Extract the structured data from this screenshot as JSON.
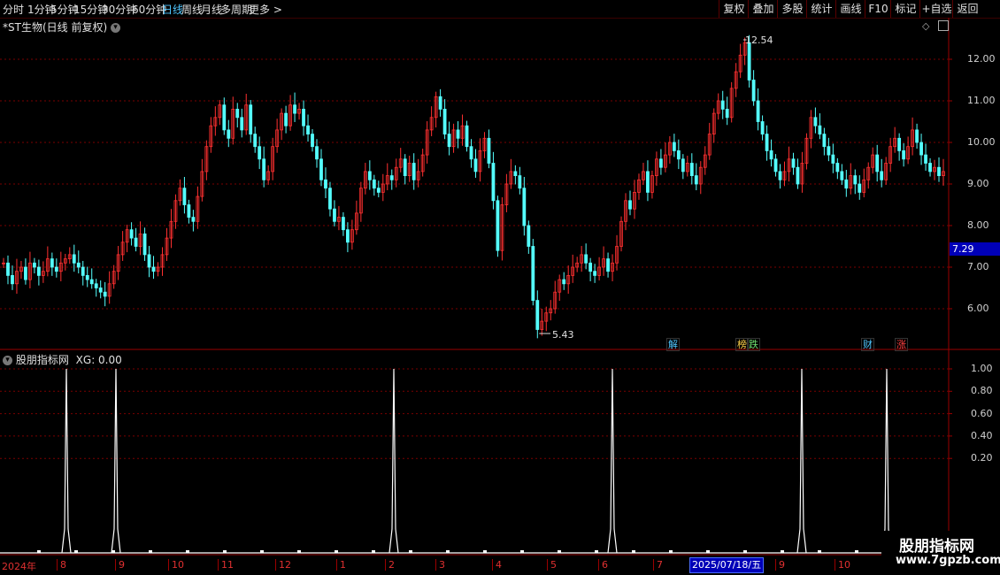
{
  "toolbar": {
    "periods": [
      "分时",
      "1分钟",
      "5分钟",
      "15分钟",
      "30分钟",
      "60分钟",
      "日线",
      "周线",
      "月线",
      "多周期",
      "更多"
    ],
    "active_period": "日线",
    "more_arrow": ">",
    "tools": [
      "复权",
      "叠加",
      "多股",
      "统计",
      "画线",
      "F10",
      "标记",
      "+自选",
      "返回"
    ]
  },
  "main_chart": {
    "title": "*ST生物(日线 前复权)",
    "price_ticks": [
      "12.00",
      "11.00",
      "10.00",
      "9.00",
      "8.00",
      "7.00",
      "6.00"
    ],
    "current_price": "7.29",
    "high_label": "12.54",
    "low_label": "5.43",
    "event_marks": [
      {
        "text": "解",
        "color": "#4fc6ff"
      },
      {
        "text": "榜",
        "color": "#ffd24a"
      },
      {
        "text": "跌",
        "color": "#6fe06f"
      },
      {
        "text": "财",
        "color": "#4fc6ff"
      },
      {
        "text": "涨",
        "color": "#ff4040"
      }
    ]
  },
  "indicator": {
    "name": "股朋指标网",
    "xg_label": "XG: 0.00",
    "ticks": [
      "1.00",
      "0.80",
      "0.60",
      "0.40",
      "0.20"
    ],
    "signals": [
      1,
      1,
      1,
      1,
      1,
      1
    ]
  },
  "time_axis": {
    "year_label": "2024年",
    "months": [
      "8",
      "9",
      "10",
      "11",
      "12",
      "1",
      "2",
      "3",
      "4",
      "5",
      "6",
      "7",
      "9",
      "10"
    ],
    "cursor_date": "2025/07/18/五"
  },
  "watermark": {
    "title": "股朋指标网",
    "url": "www.7gpzb.com"
  },
  "colors": {
    "up": "#ff3030",
    "down": "#54ffff",
    "grid": "#7a0000",
    "active": "#4fc6ff"
  },
  "chart_data": {
    "type": "candlestick",
    "title": "*ST生物(日线 前复权)",
    "ylim": [
      5.2,
      12.7
    ],
    "close": [
      7.1,
      6.8,
      6.6,
      6.9,
      7.0,
      6.7,
      7.1,
      7.0,
      6.8,
      6.9,
      7.2,
      7.0,
      6.9,
      7.1,
      7.2,
      7.3,
      7.1,
      7.0,
      6.8,
      6.7,
      6.6,
      6.5,
      6.4,
      6.3,
      6.6,
      6.9,
      7.3,
      7.6,
      7.9,
      7.7,
      7.5,
      7.8,
      7.3,
      7.0,
      6.9,
      7.0,
      7.3,
      7.7,
      8.1,
      8.6,
      8.9,
      8.5,
      8.2,
      8.1,
      8.7,
      9.3,
      9.9,
      10.4,
      10.6,
      10.9,
      10.3,
      10.1,
      10.8,
      10.6,
      10.3,
      10.9,
      10.2,
      9.9,
      9.6,
      9.1,
      9.3,
      9.9,
      10.3,
      10.7,
      10.4,
      10.9,
      10.7,
      10.8,
      10.4,
      10.2,
      9.9,
      9.6,
      9.1,
      8.9,
      8.4,
      8.1,
      8.2,
      7.9,
      7.6,
      7.9,
      8.3,
      8.9,
      9.3,
      9.1,
      8.9,
      8.8,
      9.0,
      9.2,
      9.1,
      9.4,
      9.6,
      9.2,
      9.5,
      9.1,
      9.3,
      9.7,
      10.3,
      10.6,
      11.1,
      10.8,
      10.2,
      9.9,
      10.3,
      10.1,
      10.4,
      9.9,
      9.6,
      9.3,
      9.8,
      10.1,
      9.5,
      8.6,
      7.4,
      8.5,
      9.0,
      9.3,
      9.2,
      8.9,
      8.0,
      7.5,
      6.2,
      5.5,
      5.7,
      5.9,
      6.0,
      6.4,
      6.7,
      6.6,
      6.8,
      7.0,
      7.1,
      7.3,
      7.1,
      6.9,
      6.8,
      7.0,
      7.2,
      6.9,
      7.1,
      7.5,
      8.1,
      8.6,
      8.4,
      8.8,
      9.1,
      9.3,
      8.8,
      9.2,
      9.6,
      9.4,
      9.7,
      10.0,
      9.8,
      9.6,
      9.3,
      9.5,
      9.2,
      9.0,
      9.4,
      9.7,
      10.2,
      10.7,
      11.0,
      10.8,
      10.6,
      11.3,
      11.7,
      12.1,
      12.4,
      11.5,
      11.0,
      10.5,
      10.2,
      9.8,
      9.6,
      9.3,
      9.1,
      9.3,
      9.6,
      9.4,
      9.0,
      9.5,
      10.1,
      10.6,
      10.4,
      10.2,
      9.9,
      9.7,
      9.5,
      9.3,
      9.1,
      8.9,
      9.2,
      9.0,
      8.8,
      9.1,
      9.4,
      9.7,
      9.3,
      9.1,
      9.5,
      9.9,
      10.1,
      9.8,
      9.6,
      9.9,
      10.3,
      10.0,
      9.7,
      9.5,
      9.3,
      9.4,
      9.2,
      9.3
    ]
  }
}
